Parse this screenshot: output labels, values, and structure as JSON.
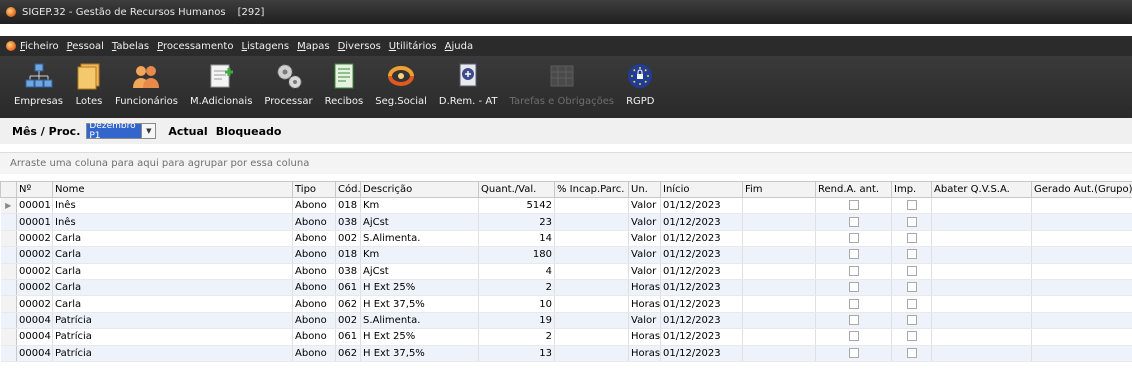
{
  "window": {
    "title": "SIGEP.32 - Gestão de Recursos Humanos",
    "count": "[292]"
  },
  "menu": [
    {
      "label": "Ficheiro"
    },
    {
      "label": "Pessoal"
    },
    {
      "label": "Tabelas"
    },
    {
      "label": "Processamento"
    },
    {
      "label": "Listagens"
    },
    {
      "label": "Mapas"
    },
    {
      "label": "Diversos"
    },
    {
      "label": "Utilitários"
    },
    {
      "label": "Ajuda"
    }
  ],
  "toolbar": {
    "empresas": "Empresas",
    "lotes": "Lotes",
    "funcionarios": "Funcionários",
    "madicionais": "M.Adicionais",
    "processar": "Processar",
    "recibos": "Recibos",
    "segsocial": "Seg.Social",
    "drem": "D.Rem. - AT",
    "tarefas": "Tarefas e Obrigações",
    "rgpd": "RGPD"
  },
  "period": {
    "label": "Mês / Proc.",
    "value": "Dezembro P1",
    "actual": "Actual",
    "blocked": "Bloqueado"
  },
  "group_hint": "Arraste uma coluna para aqui para agrupar por essa coluna",
  "columns": {
    "num": "Nº",
    "nome": "Nome",
    "tipo": "Tipo",
    "cod": "Cód.",
    "desc": "Descrição",
    "quant": "Quant./Val.",
    "incap": "% Incap.Parc.",
    "un": "Un.",
    "inicio": "Início",
    "fim": "Fim",
    "rend": "Rend.A. ant.",
    "imp": "Imp.",
    "abater": "Abater Q.V.S.A.",
    "gerado": "Gerado Aut.(Grupo)"
  },
  "rows": [
    {
      "num": "00001",
      "nome": "Inês",
      "tipo": "Abono",
      "cod": "018",
      "desc": "Km",
      "quant": "5142",
      "un": "Valor",
      "inicio": "01/12/2023"
    },
    {
      "num": "00001",
      "nome": "Inês",
      "tipo": "Abono",
      "cod": "038",
      "desc": "AjCst",
      "quant": "23",
      "un": "Valor",
      "inicio": "01/12/2023"
    },
    {
      "num": "00002",
      "nome": "Carla",
      "tipo": "Abono",
      "cod": "002",
      "desc": "S.Alimenta.",
      "quant": "14",
      "un": "Valor",
      "inicio": "01/12/2023"
    },
    {
      "num": "00002",
      "nome": "Carla",
      "tipo": "Abono",
      "cod": "018",
      "desc": "Km",
      "quant": "180",
      "un": "Valor",
      "inicio": "01/12/2023"
    },
    {
      "num": "00002",
      "nome": "Carla",
      "tipo": "Abono",
      "cod": "038",
      "desc": "AjCst",
      "quant": "4",
      "un": "Valor",
      "inicio": "01/12/2023"
    },
    {
      "num": "00002",
      "nome": "Carla",
      "tipo": "Abono",
      "cod": "061",
      "desc": "H Ext 25%",
      "quant": "2",
      "un": "Horas",
      "inicio": "01/12/2023"
    },
    {
      "num": "00002",
      "nome": "Carla",
      "tipo": "Abono",
      "cod": "062",
      "desc": "H Ext 37,5%",
      "quant": "10",
      "un": "Horas",
      "inicio": "01/12/2023"
    },
    {
      "num": "00004",
      "nome": "Patrícia",
      "tipo": "Abono",
      "cod": "002",
      "desc": "S.Alimenta.",
      "quant": "19",
      "un": "Valor",
      "inicio": "01/12/2023"
    },
    {
      "num": "00004",
      "nome": "Patrícia",
      "tipo": "Abono",
      "cod": "061",
      "desc": "H Ext 25%",
      "quant": "2",
      "un": "Horas",
      "inicio": "01/12/2023"
    },
    {
      "num": "00004",
      "nome": "Patrícia",
      "tipo": "Abono",
      "cod": "062",
      "desc": "H Ext 37,5%",
      "quant": "13",
      "un": "Horas",
      "inicio": "01/12/2023"
    }
  ]
}
